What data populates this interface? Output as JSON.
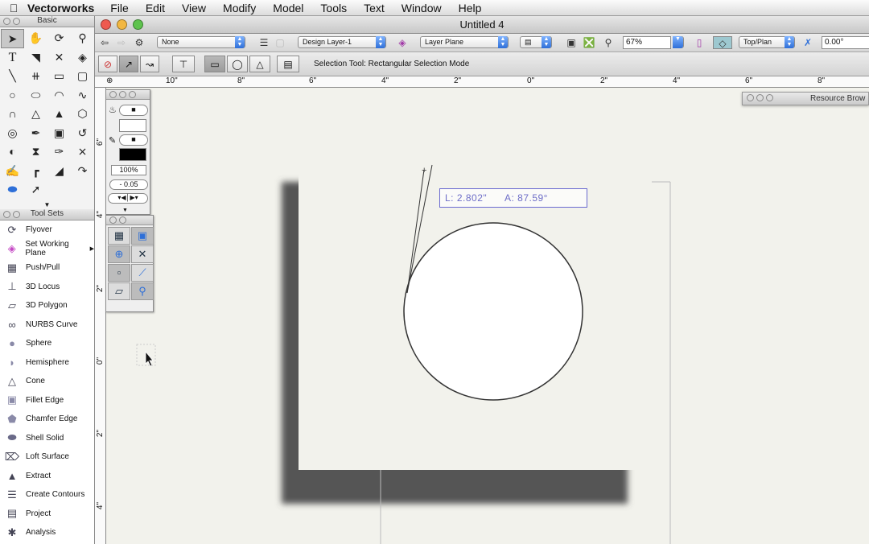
{
  "menubar": {
    "app_name": "Vectorworks",
    "items": [
      "File",
      "Edit",
      "View",
      "Modify",
      "Model",
      "Tools",
      "Text",
      "Window",
      "Help"
    ]
  },
  "window": {
    "title": "Untitled 4"
  },
  "viewbar": {
    "class_select": "None",
    "layer_select": "Design Layer-1",
    "plane_select": "Layer Plane",
    "zoom": "67%",
    "view_select": "Top/Plan",
    "rotation": "0.00°"
  },
  "modebar": {
    "message": "Selection Tool: Rectangular Selection Mode"
  },
  "rulers": {
    "horizontal": [
      "10\"",
      "8\"",
      "6\"",
      "4\"",
      "2\"",
      "0\"",
      "2\"",
      "4\"",
      "6\"",
      "8\""
    ],
    "vertical": [
      "6\"",
      "4\"",
      "2\"",
      "0\"",
      "2\"",
      "4\""
    ]
  },
  "palettes": {
    "basic_title": "Basic",
    "toolsets_title": "Tool Sets",
    "resource_browser_title": "Resource Brow"
  },
  "attributes": {
    "opacity": "100%",
    "line_weight": "- 0.05"
  },
  "toolsets": [
    {
      "label": "Flyover",
      "icon": "flyover-icon"
    },
    {
      "label": "Set Working Plane",
      "icon": "working-plane-icon"
    },
    {
      "label": "Push/Pull",
      "icon": "push-pull-icon"
    },
    {
      "label": "3D Locus",
      "icon": "locus-icon"
    },
    {
      "label": "3D Polygon",
      "icon": "polygon-3d-icon"
    },
    {
      "label": "NURBS Curve",
      "icon": "nurbs-icon"
    },
    {
      "label": "Sphere",
      "icon": "sphere-icon"
    },
    {
      "label": "Hemisphere",
      "icon": "hemisphere-icon"
    },
    {
      "label": "Cone",
      "icon": "cone-icon"
    },
    {
      "label": "Fillet Edge",
      "icon": "fillet-edge-icon"
    },
    {
      "label": "Chamfer Edge",
      "icon": "chamfer-edge-icon"
    },
    {
      "label": "Shell Solid",
      "icon": "shell-solid-icon"
    },
    {
      "label": "Loft Surface",
      "icon": "loft-surface-icon"
    },
    {
      "label": "Extract",
      "icon": "extract-icon"
    },
    {
      "label": "Create Contours",
      "icon": "contours-icon"
    },
    {
      "label": "Project",
      "icon": "project-icon"
    },
    {
      "label": "Analysis",
      "icon": "analysis-icon"
    }
  ],
  "dataline": {
    "length": "L: 2.802\"",
    "angle": "A: 87.59°"
  },
  "colors": {
    "accent": "#2e6fd8",
    "dataline": "#6e6ec8",
    "shadow": "#555555"
  }
}
